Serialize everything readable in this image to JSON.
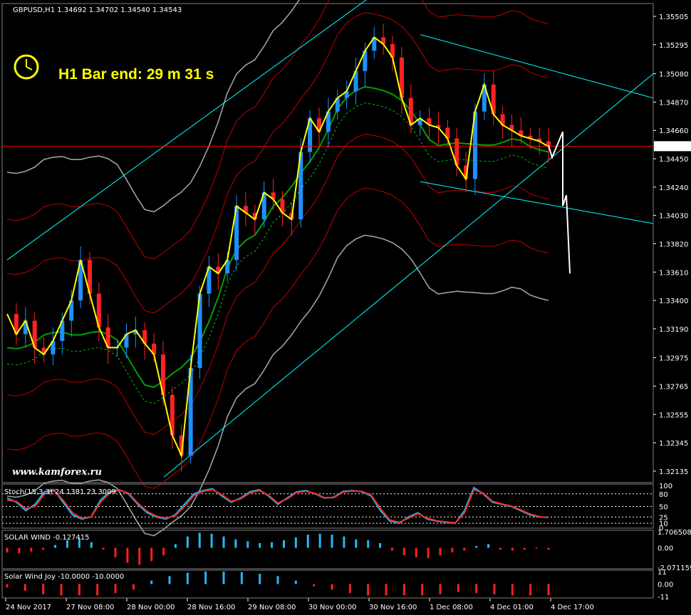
{
  "header": {
    "symbol_line": "GBPUSD,H1  1.34692 1.34702 1.34540 1.34543",
    "timer_text": "H1 Bar end: 29 m 31 s",
    "watermark": "www.kamforex.ru"
  },
  "colors": {
    "background": "#000000",
    "up_candle": "#1e90ff",
    "down_candle": "#ff2222",
    "price_line": "#ff0000",
    "channel": "#00ffff",
    "timer_text": "#ffff00",
    "fast_ma": "#ffff00",
    "slow_ma": "#00a000",
    "envelope_outer": "#a0a0a0",
    "envelope_inner": "#c00000",
    "zigzag_projection": "#ffffff"
  },
  "chart_data": [
    {
      "type": "candlestick",
      "symbol": "GBPUSD",
      "timeframe": "H1",
      "ohlc_last": {
        "open": 1.34692,
        "high": 1.34702,
        "low": 1.3454,
        "close": 1.34543
      },
      "current_price_label": "1.34543",
      "y_ticks": [
        "1.35505",
        "1.35295",
        "1.35080",
        "1.34870",
        "1.34660",
        "1.34450",
        "1.34240",
        "1.34030",
        "1.33820",
        "1.33610",
        "1.33400",
        "1.33190",
        "1.32975",
        "1.32765",
        "1.32555",
        "1.32345",
        "1.32135"
      ],
      "ylim": [
        1.3205,
        1.356
      ],
      "x_labels": [
        "24 Nov 2017",
        "27 Nov 08:00",
        "28 Nov 00:00",
        "28 Nov 16:00",
        "29 Nov 08:00",
        "30 Nov 00:00",
        "30 Nov 16:00",
        "1 Dec 08:00",
        "4 Dec 01:00",
        "4 Dec 17:00"
      ],
      "close_path": [
        1.333,
        1.3315,
        1.3325,
        1.3305,
        1.33,
        1.331,
        1.3325,
        1.334,
        1.337,
        1.3345,
        1.332,
        1.3305,
        1.3305,
        1.3315,
        1.3318,
        1.3308,
        1.33,
        1.327,
        1.324,
        1.3225,
        1.329,
        1.3345,
        1.3365,
        1.336,
        1.337,
        1.341,
        1.3405,
        1.34,
        1.342,
        1.3415,
        1.3405,
        1.34,
        1.345,
        1.3475,
        1.3465,
        1.348,
        1.349,
        1.3495,
        1.351,
        1.3525,
        1.3535,
        1.353,
        1.352,
        1.349,
        1.347,
        1.3475,
        1.347,
        1.3468,
        1.346,
        1.344,
        1.343,
        1.348,
        1.35,
        1.3478,
        1.347,
        1.3466,
        1.3462,
        1.346,
        1.3458,
        1.3454
      ]
    },
    {
      "type": "line",
      "title": "Stoch(15,3,3) 24.1381 23.3009",
      "y_ticks": [
        "100",
        "80",
        "50",
        "25",
        "10",
        "0"
      ],
      "ylim": [
        0,
        100
      ],
      "series": [
        {
          "color": "#00bfff",
          "values": [
            70,
            60,
            40,
            55,
            85,
            90,
            60,
            30,
            20,
            25,
            65,
            85,
            90,
            80,
            55,
            35,
            25,
            20,
            30,
            55,
            80,
            88,
            92,
            75,
            60,
            70,
            85,
            90,
            75,
            55,
            70,
            85,
            88,
            80,
            70,
            72,
            86,
            88,
            85,
            75,
            40,
            15,
            10,
            25,
            35,
            20,
            15,
            12,
            10,
            40,
            95,
            80,
            60,
            55,
            50,
            40,
            30,
            25,
            24
          ]
        },
        {
          "color": "#ff2a2a",
          "values": [
            65,
            62,
            45,
            50,
            80,
            88,
            65,
            35,
            22,
            25,
            60,
            82,
            89,
            82,
            58,
            38,
            27,
            22,
            28,
            50,
            76,
            86,
            90,
            78,
            62,
            68,
            82,
            88,
            77,
            58,
            68,
            83,
            86,
            81,
            71,
            71,
            84,
            87,
            86,
            77,
            45,
            18,
            12,
            22,
            33,
            22,
            16,
            13,
            11,
            35,
            90,
            82,
            62,
            56,
            51,
            42,
            32,
            26,
            23
          ]
        }
      ]
    },
    {
      "type": "bar",
      "title": "SOLAR WIND -0.127415",
      "y_ticks": [
        "1.706508",
        "0.00",
        "-2.071159"
      ],
      "ylim": [
        -2.071159,
        1.706508
      ],
      "values": [
        -0.5,
        -0.6,
        -0.4,
        -0.2,
        0.3,
        0.8,
        1.0,
        0.6,
        -0.2,
        -1.0,
        -1.6,
        -1.8,
        -1.4,
        -0.8,
        0.4,
        1.2,
        1.6,
        1.5,
        1.2,
        0.9,
        0.7,
        0.5,
        0.6,
        0.8,
        1.1,
        1.4,
        1.5,
        1.4,
        1.2,
        0.9,
        0.8,
        0.5,
        -0.3,
        -0.8,
        -1.0,
        -1.1,
        -0.8,
        -0.5,
        -0.3,
        0.2,
        0.4,
        -0.2,
        -0.3,
        -0.2,
        -0.1,
        -0.2
      ]
    },
    {
      "type": "bar",
      "title": "Solar Wind Joy -10.0000 -10.0000",
      "y_ticks": [
        "11",
        "0.00",
        "-11"
      ],
      "ylim": [
        -11,
        11
      ],
      "values": [
        -3,
        -6,
        -9,
        -10,
        -10,
        -10,
        -8,
        -5,
        3,
        7,
        10,
        11,
        11,
        10.5,
        9,
        7,
        3,
        -2,
        -5,
        -8,
        -10,
        -10,
        -10,
        -10,
        -9,
        -7,
        -8,
        -9,
        -10,
        -10,
        -10
      ]
    }
  ]
}
